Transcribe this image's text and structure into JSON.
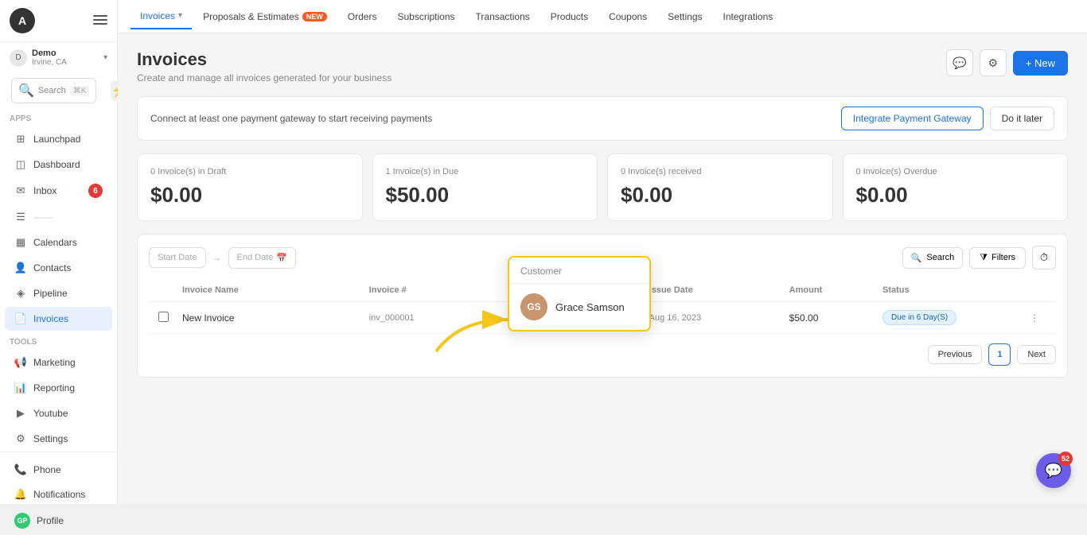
{
  "sidebar": {
    "logo_letter": "A",
    "org": {
      "name": "Demo",
      "location": "Irvine, CA",
      "chevron": "▾"
    },
    "search": {
      "placeholder": "Search",
      "shortcut": "⌘K"
    },
    "apps_label": "Apps",
    "tools_label": "Tools",
    "items": [
      {
        "id": "launchpad",
        "label": "Launchpad",
        "icon": "⊞",
        "badge": null
      },
      {
        "id": "dashboard",
        "label": "Dashboard",
        "icon": "◫",
        "badge": null
      },
      {
        "id": "inbox",
        "label": "Inbox",
        "icon": "✉",
        "badge": "6"
      },
      {
        "id": "unknown",
        "label": "...",
        "icon": "☰",
        "badge": null
      },
      {
        "id": "calendars",
        "label": "Calendars",
        "icon": "📅",
        "badge": null
      },
      {
        "id": "contacts",
        "label": "Contacts",
        "icon": "👤",
        "badge": null
      },
      {
        "id": "pipeline",
        "label": "Pipeline",
        "icon": "◈",
        "badge": null
      },
      {
        "id": "invoices",
        "label": "Invoices",
        "icon": "📄",
        "badge": null,
        "active": true
      }
    ],
    "tool_items": [
      {
        "id": "marketing",
        "label": "Marketing",
        "icon": "📢"
      },
      {
        "id": "reporting",
        "label": "Reporting",
        "icon": "📊"
      },
      {
        "id": "youtube",
        "label": "Youtube",
        "icon": "▶"
      },
      {
        "id": "settings",
        "label": "Settings",
        "icon": "⚙"
      }
    ],
    "bottom_items": [
      {
        "id": "phone",
        "label": "Phone",
        "icon": "📞"
      },
      {
        "id": "notifications",
        "label": "Notifications",
        "icon": "🔔"
      },
      {
        "id": "profile",
        "label": "Profile",
        "icon": "GP"
      }
    ]
  },
  "topnav": {
    "items": [
      {
        "id": "invoices",
        "label": "Invoices",
        "active": true,
        "chevron": true,
        "badge": null
      },
      {
        "id": "proposals",
        "label": "Proposals & Estimates",
        "active": false,
        "chevron": false,
        "badge": "NEW"
      },
      {
        "id": "orders",
        "label": "Orders",
        "active": false
      },
      {
        "id": "subscriptions",
        "label": "Subscriptions",
        "active": false
      },
      {
        "id": "transactions",
        "label": "Transactions",
        "active": false
      },
      {
        "id": "products",
        "label": "Products",
        "active": false
      },
      {
        "id": "coupons",
        "label": "Coupons",
        "active": false
      },
      {
        "id": "settings",
        "label": "Settings",
        "active": false
      },
      {
        "id": "integrations",
        "label": "Integrations",
        "active": false
      }
    ]
  },
  "page": {
    "title": "Invoices",
    "subtitle": "Create and manage all invoices generated for your business",
    "header_actions": {
      "comment_icon": "💬",
      "gear_icon": "⚙",
      "new_button": "+ New"
    }
  },
  "banner": {
    "text": "Connect at least one payment gateway to start receiving payments",
    "integrate_btn": "Integrate Payment Gateway",
    "later_btn": "Do it later"
  },
  "stats": [
    {
      "label": "0 Invoice(s) in Draft",
      "value": "$0.00"
    },
    {
      "label": "1 Invoice(s) in Due",
      "value": "$50.00"
    },
    {
      "label": "0 Invoice(s) received",
      "value": "$0.00"
    },
    {
      "label": "0 Invoice(s) Overdue",
      "value": "$0.00"
    }
  ],
  "table": {
    "date_start": "Start Date",
    "date_end": "End Date",
    "search_placeholder": "Search",
    "filters_btn": "Filters",
    "columns": [
      "Invoice Name",
      "Invoice #",
      "Customer",
      "Issue Date",
      "Amount",
      "Status"
    ],
    "rows": [
      {
        "name": "New Invoice",
        "id": "inv_000001",
        "customer": "Grace Samson",
        "customer_initials": "GS",
        "issue_date": "Aug 16, 2023",
        "amount": "$50.00",
        "status": "Due in 6 Day(S)"
      }
    ],
    "pagination": {
      "previous": "Previous",
      "page": "1",
      "next": "Next"
    }
  },
  "tooltip": {
    "header": "Customer",
    "customer_initials": "GS",
    "customer_name": "Grace Samson"
  },
  "chat": {
    "icon": "💬",
    "badge": "52"
  }
}
